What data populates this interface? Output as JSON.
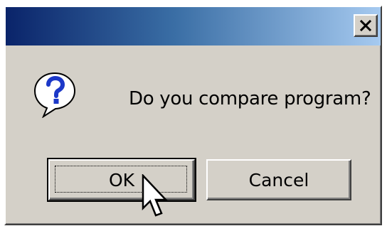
{
  "dialog": {
    "title": "",
    "message": "Do you compare program?",
    "icon": "question-icon",
    "buttons": {
      "ok_label": "OK",
      "cancel_label": "Cancel"
    },
    "close_icon": "close-icon"
  },
  "colors": {
    "face": "#d4d0c8",
    "title_start": "#0a246a",
    "title_end": "#a6caf0",
    "icon_blue": "#1c38c8"
  }
}
